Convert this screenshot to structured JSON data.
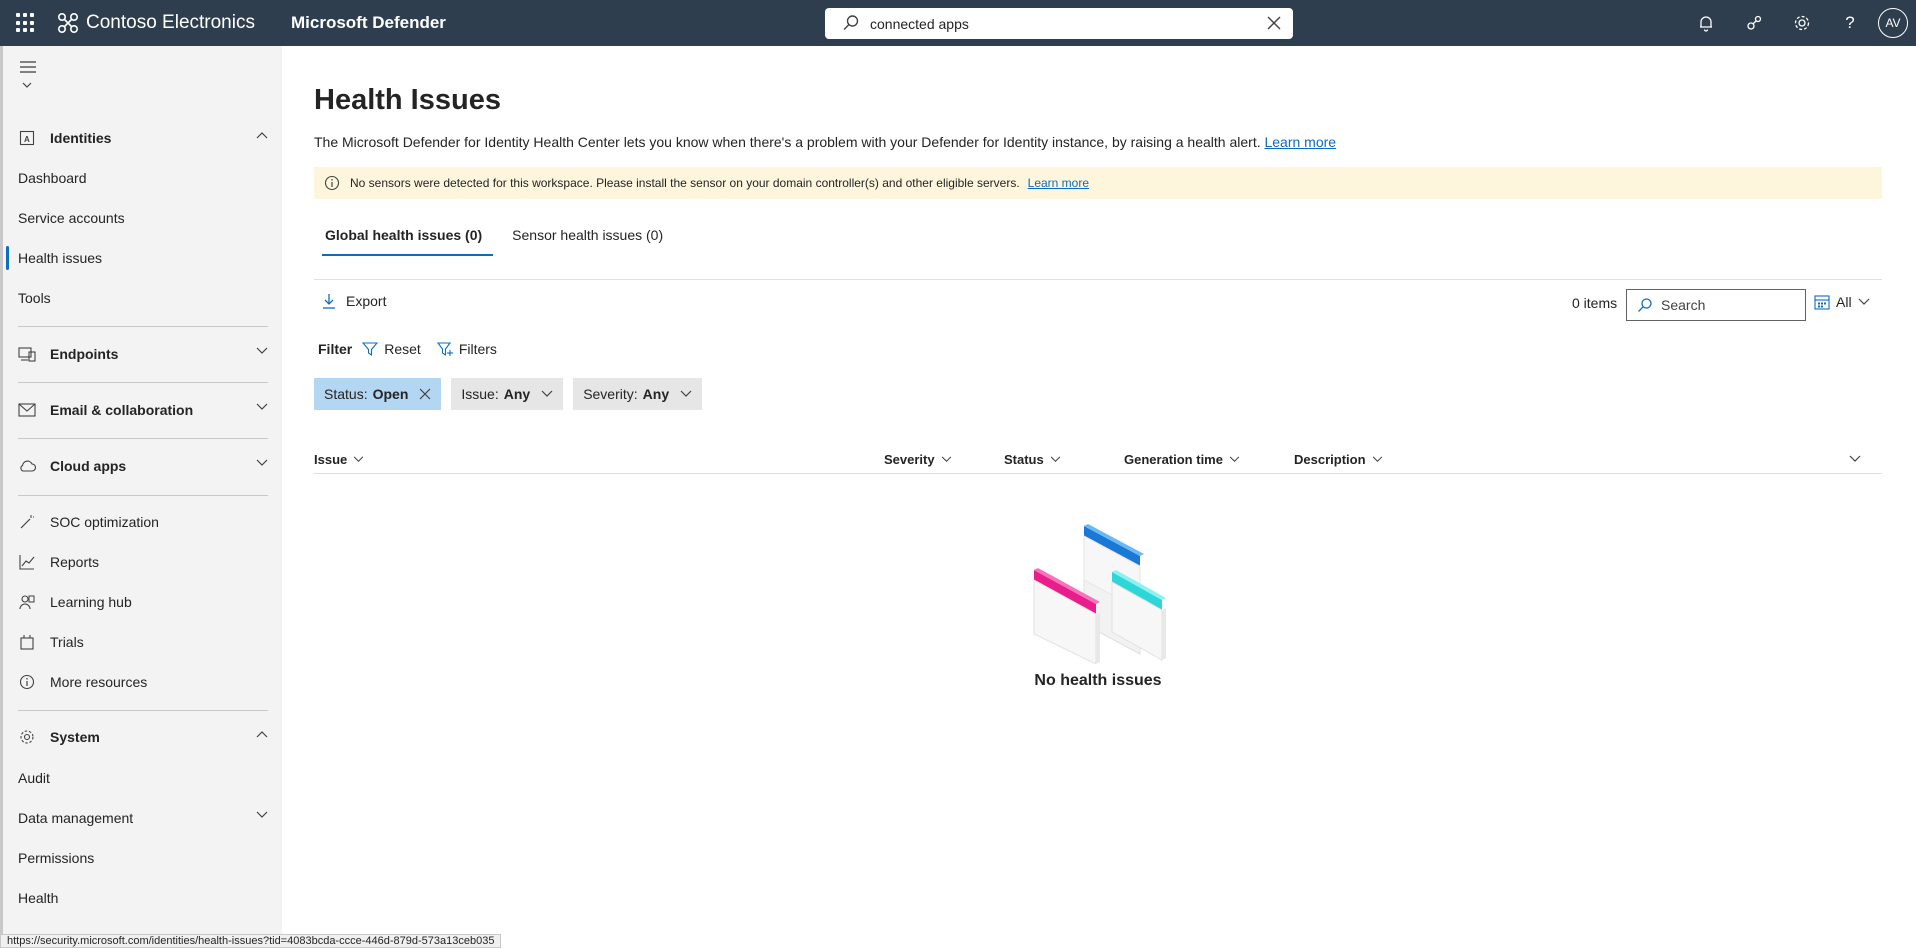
{
  "topbar": {
    "org_name": "Contoso Electronics",
    "product_name": "Microsoft Defender",
    "search_value": "connected apps",
    "avatar_initials": "AV"
  },
  "sidebar": {
    "sections": [
      {
        "key": "identities",
        "label": "Identities",
        "expanded": true
      },
      {
        "key": "endpoints",
        "label": "Endpoints",
        "expanded": false
      },
      {
        "key": "email",
        "label": "Email & collaboration",
        "expanded": false
      },
      {
        "key": "cloud",
        "label": "Cloud apps",
        "expanded": false
      },
      {
        "key": "system",
        "label": "System",
        "expanded": true
      }
    ],
    "identities_items": [
      "Dashboard",
      "Service accounts",
      "Health issues",
      "Tools"
    ],
    "active_item": "Health issues",
    "misc_items": [
      "SOC optimization",
      "Reports",
      "Learning hub",
      "Trials",
      "More resources"
    ],
    "system_items": [
      "Audit",
      "Data management",
      "Permissions",
      "Health"
    ]
  },
  "main": {
    "title": "Health Issues",
    "description": "The Microsoft Defender for Identity Health Center lets you know when there's a problem with your Defender for Identity instance, by raising a health alert.",
    "description_link": "Learn more",
    "banner_text": "No sensors were detected for this workspace. Please install the sensor on your domain controller(s) and other eligible servers.",
    "banner_link": "Learn more",
    "tabs": [
      {
        "label": "Global health issues (0)",
        "active": true
      },
      {
        "label": "Sensor health issues (0)",
        "active": false
      }
    ],
    "export_label": "Export",
    "items_count": "0 items",
    "search_placeholder": "Search",
    "date_filter": "All",
    "filter_label": "Filter",
    "reset_label": "Reset",
    "filters_label": "Filters",
    "pills": [
      {
        "key": "Status:",
        "value": "Open",
        "active": true
      },
      {
        "key": "Issue:",
        "value": "Any",
        "active": false
      },
      {
        "key": "Severity:",
        "value": "Any",
        "active": false
      }
    ],
    "columns": [
      "Issue",
      "Severity",
      "Status",
      "Generation time",
      "Description"
    ],
    "empty_text": "No health issues"
  },
  "status_url": "https://security.microsoft.com/identities/health-issues?tid=4083bcda-ccce-446d-879d-573a13ceb035",
  "colors": {
    "topbar": "#2f3e4e",
    "accent": "#0f6cbd",
    "banner": "#fdf6dd",
    "pill_active": "#b3d6f2"
  }
}
